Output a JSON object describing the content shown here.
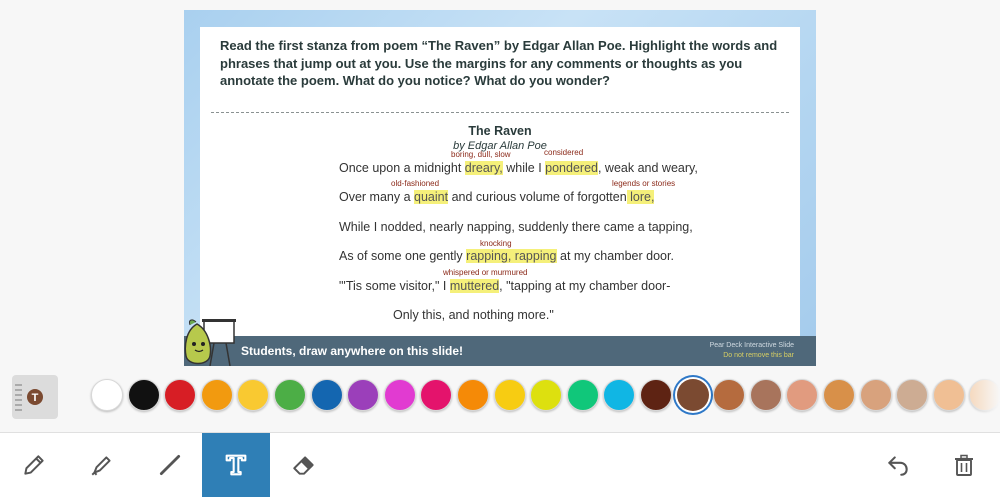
{
  "slide": {
    "prompt": "Read the first stanza from poem “The Raven” by Edgar Allan Poe. Highlight the words and phrases that jump out at you. Use the margins for any comments or thoughts as you annotate the poem. What do you notice? What do you wonder?",
    "poem_title": "The Raven",
    "poem_author": "by Edgar Allan Poe",
    "lines": {
      "l1": {
        "a": "Once upon a midnight ",
        "h1": "dreary,",
        "b": " while I ",
        "h2": "pondered",
        "c": ", weak and weary,"
      },
      "l2": {
        "a": "Over many a ",
        "h1": "quaint",
        "b": " and curious volume of forgotten",
        "h2": " lore,"
      },
      "l3": {
        "a": "While I nodded, nearly napping, suddenly there came a tapping,"
      },
      "l4": {
        "a": "As of some one gently ",
        "h1": "rapping, rapping",
        "b": " at my chamber door."
      },
      "l5": {
        "a": "\"'Tis some visitor,\" I ",
        "h1": "muttered",
        "b": ", \"tapping at my chamber door-"
      },
      "l6": {
        "a": "Only this, and nothing more.\""
      }
    },
    "annotations": {
      "n1": "boring, dull, slow",
      "n2": "considered",
      "n3": "old-fashioned",
      "n4": "legends or stories",
      "n5": "knocking",
      "n6": "whispered or murmured"
    },
    "bar": {
      "message": "Students, draw anywhere on this slide!",
      "right_title": "Pear Deck Interactive Slide",
      "right_sub": "Do not remove this bar"
    }
  },
  "palette": {
    "selected_tool_glyph": "T",
    "colors": [
      "#ffffff",
      "#111111",
      "#d71e25",
      "#f29a0f",
      "#f9c931",
      "#4cae46",
      "#1466b0",
      "#9b3fba",
      "#e13bd1",
      "#e4136c",
      "#f58a07",
      "#f7cc12",
      "#dde00f",
      "#10c77a",
      "#10b6e4",
      "#5e2313",
      "#7b4a31",
      "#b56b3e",
      "#a8745c",
      "#e19b7f",
      "#d89049",
      "#d8a27d",
      "#cdac93",
      "#f0bf94",
      "#f6d4b4"
    ],
    "selected_index": 16
  },
  "toolbar": {
    "tools": [
      "pencil-icon",
      "marker-icon",
      "line-icon",
      "text-icon",
      "eraser-icon"
    ],
    "active_tool": "text-icon",
    "right": [
      "undo-icon",
      "trash-icon"
    ]
  }
}
